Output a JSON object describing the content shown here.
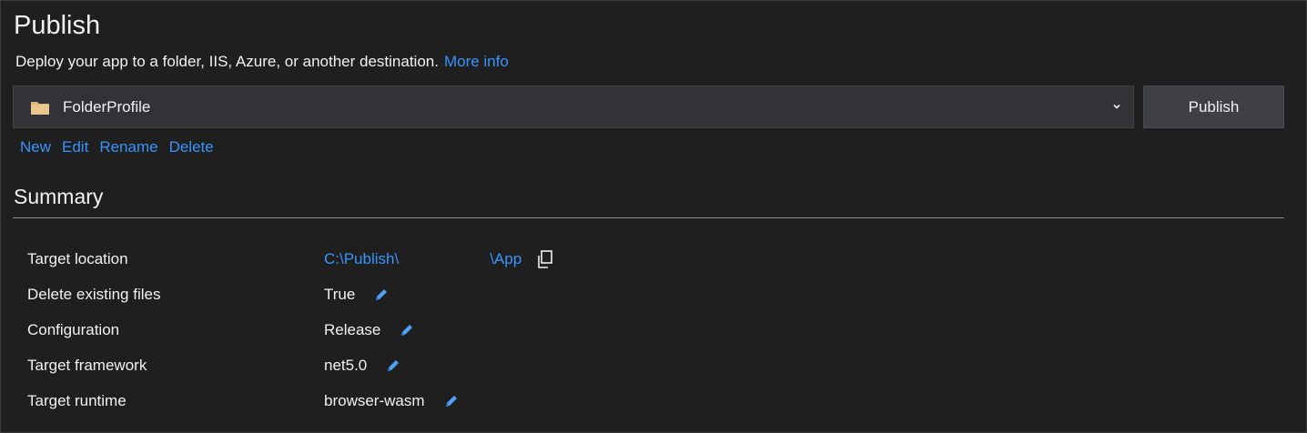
{
  "header": {
    "title": "Publish",
    "subtitle": "Deploy your app to a folder, IIS, Azure, or another destination.",
    "more_info_link": "More info"
  },
  "profile": {
    "selected": "FolderProfile",
    "icon": "folder-icon",
    "publish_button": "Publish"
  },
  "profile_actions": [
    "New",
    "Edit",
    "Rename",
    "Delete"
  ],
  "summary": {
    "heading": "Summary",
    "rows": [
      {
        "label": "Target location",
        "value_prefix": "C:\\Publish\\",
        "value_suffix": "\\App",
        "icon": "copy-icon"
      },
      {
        "label": "Delete existing files",
        "value": "True",
        "icon": "pencil-icon"
      },
      {
        "label": "Configuration",
        "value": "Release",
        "icon": "pencil-icon"
      },
      {
        "label": "Target framework",
        "value": "net5.0",
        "icon": "pencil-icon"
      },
      {
        "label": "Target runtime",
        "value": "browser-wasm",
        "icon": "pencil-icon"
      }
    ]
  },
  "colors": {
    "background": "#1f1f1f",
    "link": "#3794ff",
    "text": "#f1f1f1",
    "folder": "#dcb67a"
  }
}
